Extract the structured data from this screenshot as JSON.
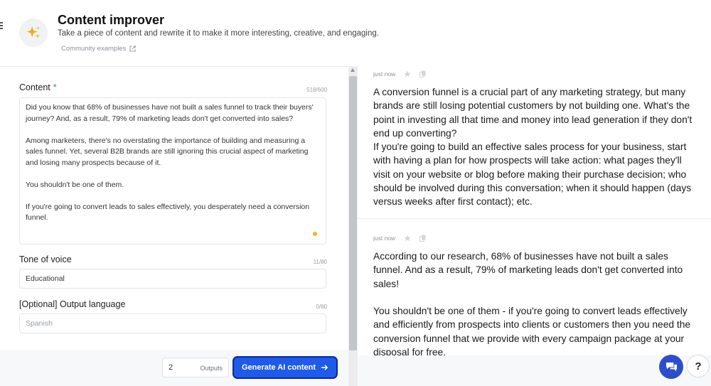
{
  "header": {
    "title": "Content improver",
    "subtitle": "Take a piece of content and rewrite it to make it more interesting, creative, and engaging.",
    "community_link": "Community examples",
    "app_icon": "sparkles-icon"
  },
  "form": {
    "content": {
      "label": "Content",
      "required_mark": "*",
      "counter": "518/600",
      "value": "Did you know that 68% of businesses have not built a sales funnel to track their buyers' journey? And, as a result, 79% of marketing leads don't get converted into sales?\n\nAmong marketers, there's no overstating the importance of building and measuring a sales funnel. Yet, several B2B brands are still ignoring this crucial aspect of marketing and losing many prospects because of it.\n\nYou shouldn't be one of them.\n\nIf you're going to convert leads to sales effectively, you desperately need a conversion funnel."
    },
    "tone": {
      "label": "Tone of voice",
      "counter": "11/80",
      "value": "Educational"
    },
    "language": {
      "label": "[Optional] Output language",
      "counter": "0/80",
      "placeholder": "Spanish"
    }
  },
  "controls": {
    "outputs_value": "2",
    "outputs_label": "Outputs",
    "generate_label": "Generate AI content",
    "generate_icon": "arrow-right-icon",
    "accent_color": "#1f5be8"
  },
  "results": [
    {
      "timestamp": "just now",
      "text": "A conversion funnel is a crucial part of any marketing strategy, but many brands are still losing potential customers by not building one. What's the point in investing all that time and money into lead generation if they don't end up converting?\nIf you're going to build an effective sales process for your business, start with having a plan for how prospects will take action: what pages they'll visit on your website or blog before making their purchase decision; who should be involved during this conversation; when it should happen (days versus weeks after first contact); etc."
    },
    {
      "timestamp": "just now",
      "text": "According to our research, 68% of businesses have not built a sales funnel. And as a result, 79% of marketing leads don't get converted into sales!\n\nYou shouldn't be one of them - if you're going to convert leads effectively and efficiently from prospects into clients or customers then you need the conversion funnel that we provide with every campaign package at your disposal for free."
    }
  ],
  "floating": {
    "chat_icon": "chat-icon",
    "help_label": "?"
  }
}
